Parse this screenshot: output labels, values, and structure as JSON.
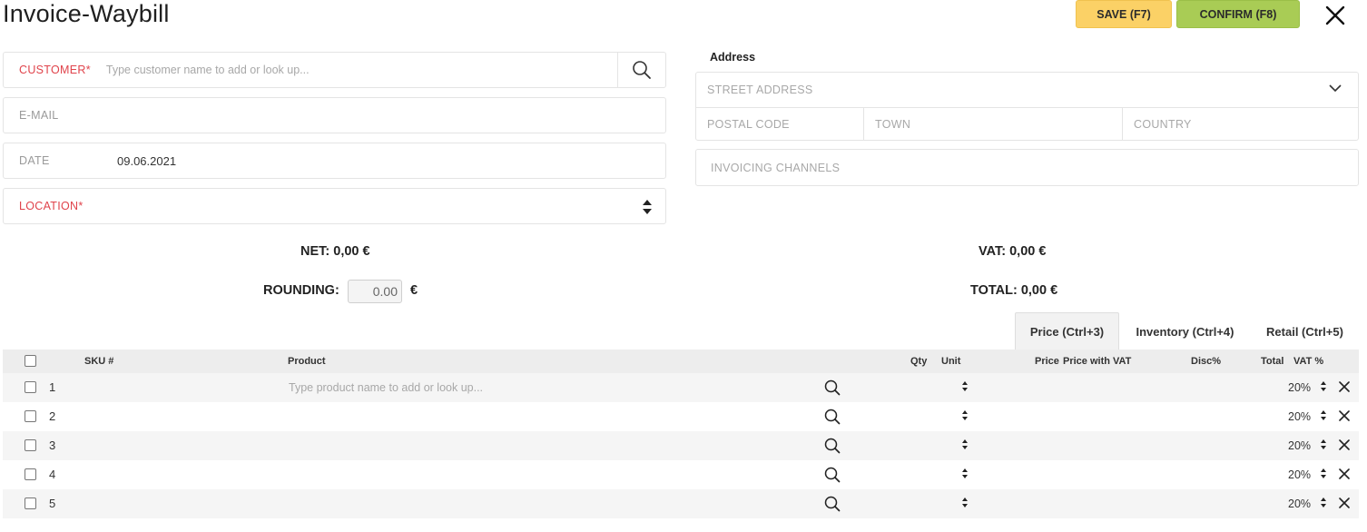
{
  "header": {
    "title": "Invoice-Waybill",
    "save_label": "SAVE (F7)",
    "confirm_label": "CONFIRM (F8)"
  },
  "form": {
    "customer_label": "CUSTOMER*",
    "customer_placeholder": "Type customer name to add or look up...",
    "email_label": "E-MAIL",
    "date_label": "DATE",
    "date_value": "09.06.2021",
    "location_label": "LOCATION*"
  },
  "address": {
    "heading": "Address",
    "street_placeholder": "STREET ADDRESS",
    "postal_placeholder": "POSTAL CODE",
    "town_placeholder": "TOWN",
    "country_placeholder": "COUNTRY",
    "channels_placeholder": "INVOICING CHANNELS"
  },
  "summary": {
    "net": "NET: 0,00  €",
    "vat": "VAT: 0,00  €",
    "rounding_label": "ROUNDING:",
    "rounding_value": "0.00",
    "rounding_currency": "€",
    "total": "TOTAL: 0,00  €"
  },
  "tabs": [
    {
      "label": "Price (Ctrl+3)",
      "active": true
    },
    {
      "label": "Inventory (Ctrl+4)",
      "active": false
    },
    {
      "label": "Retail (Ctrl+5)",
      "active": false
    }
  ],
  "table": {
    "columns": {
      "sku": "SKU #",
      "product": "Product",
      "qty": "Qty",
      "unit": "Unit",
      "price": "Price",
      "price_vat": "Price with VAT",
      "disc": "Disc%",
      "total": "Total",
      "vat": "VAT %"
    },
    "product_placeholder": "Type product name to add or look up...",
    "rows": [
      {
        "num": "1",
        "vat": "20%"
      },
      {
        "num": "2",
        "vat": "20%"
      },
      {
        "num": "3",
        "vat": "20%"
      },
      {
        "num": "4",
        "vat": "20%"
      },
      {
        "num": "5",
        "vat": "20%"
      }
    ]
  },
  "colors": {
    "save": "#fbd166",
    "confirm": "#a9cc55",
    "required": "#e0434b"
  }
}
